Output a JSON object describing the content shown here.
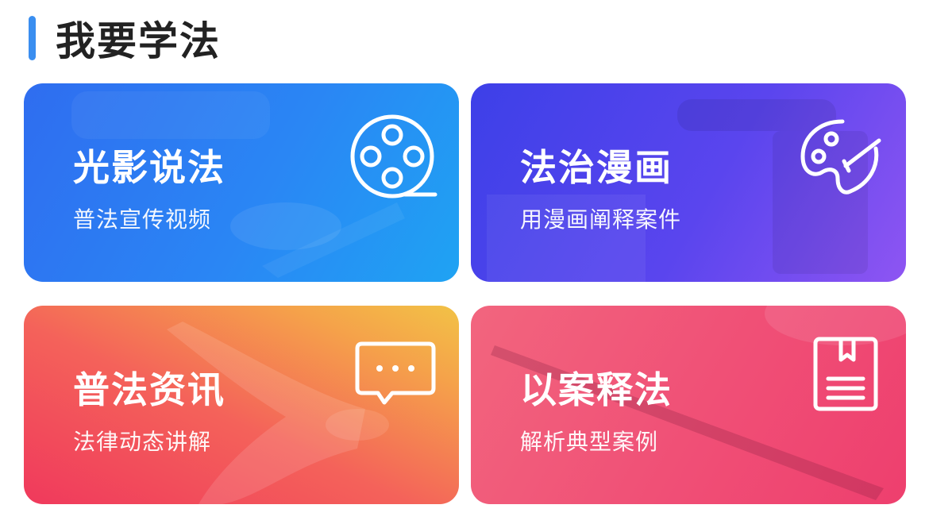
{
  "section": {
    "title": "我要学法",
    "accent_color": "#3a8ef0"
  },
  "cards": [
    {
      "title": "光影说法",
      "subtitle": "普法宣传视频",
      "icon": "film-reel-icon",
      "color": "#2a86f4"
    },
    {
      "title": "法治漫画",
      "subtitle": "用漫画阐释案件",
      "icon": "palette-icon",
      "color": "#5a45ee"
    },
    {
      "title": "普法资讯",
      "subtitle": "法律动态讲解",
      "icon": "chat-bubble-icon",
      "color": "#f4625a"
    },
    {
      "title": "以案释法",
      "subtitle": "解析典型案例",
      "icon": "bookmark-document-icon",
      "color": "#f04f76"
    }
  ]
}
